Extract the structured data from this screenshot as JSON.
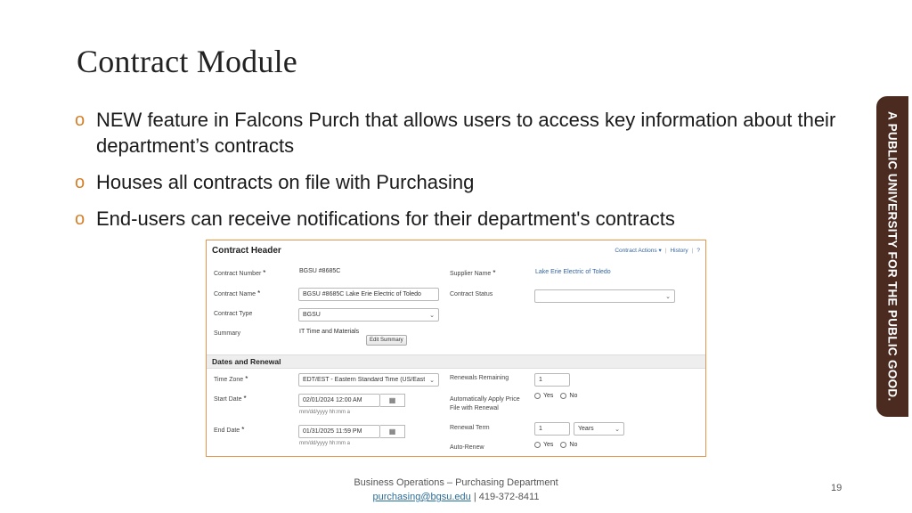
{
  "slide": {
    "title": "Contract Module",
    "bullets": [
      "NEW feature in Falcons Purch that allows users to access key information about their department’s contracts",
      "Houses all contracts on file with Purchasing",
      "End-users can receive notifications for their department's contracts"
    ],
    "bullet_marker": "o",
    "side_banner": "A PUBLIC UNIVERSITY FOR THE PUBLIC GOOD.",
    "footer": {
      "line1": "Business Operations – Purchasing Department",
      "email": "purchasing@bgsu.edu",
      "separator": "|",
      "phone": "419-372-8411"
    },
    "page_number": "19"
  },
  "colors": {
    "accent_orange": "#e8954a",
    "banner_brown": "#4b2a20",
    "link_blue": "#3465a4"
  },
  "form": {
    "header_title": "Contract Header",
    "links": {
      "actions": "Contract Actions ▾",
      "sep": "|",
      "history": "History",
      "sep2": "|",
      "help": "?"
    },
    "required_mark": "*",
    "contract_number": {
      "label": "Contract Number",
      "value": "BGSU #8685C"
    },
    "contract_name": {
      "label": "Contract Name",
      "value": "BGSU #8685C Lake Erie Electric of Toledo"
    },
    "contract_type": {
      "label": "Contract Type",
      "value": "BGSU"
    },
    "summary": {
      "label": "Summary",
      "value": "IT Time and Materials",
      "button": "Edit Summary"
    },
    "supplier_name": {
      "label": "Supplier Name",
      "value": "Lake Erie Electric of Toledo"
    },
    "contract_status": {
      "label": "Contract Status",
      "value": ""
    },
    "section_dates": "Dates and Renewal",
    "time_zone": {
      "label": "Time Zone",
      "value": "EDT/EST - Eastern Standard Time (US/East"
    },
    "start_date": {
      "label": "Start Date",
      "value": "02/01/2024 12:00 AM",
      "hint": "mm/dd/yyyy hh:mm a"
    },
    "end_date": {
      "label": "End Date",
      "value": "01/31/2025 11:59 PM",
      "hint": "mm/dd/yyyy hh:mm a"
    },
    "renewals_remaining": {
      "label": "Renewals Remaining",
      "value": "1"
    },
    "auto_apply": {
      "label_line1": "Automatically Apply Price",
      "label_line2": "File with Renewal",
      "yes": "Yes",
      "no": "No"
    },
    "renewal_term": {
      "label": "Renewal Term",
      "value": "1",
      "unit": "Years"
    },
    "auto_renew": {
      "label": "Auto-Renew",
      "yes": "Yes",
      "no": "No"
    },
    "icons": {
      "dropdown": "chevron-down-icon",
      "calendar": "calendar-icon"
    }
  }
}
